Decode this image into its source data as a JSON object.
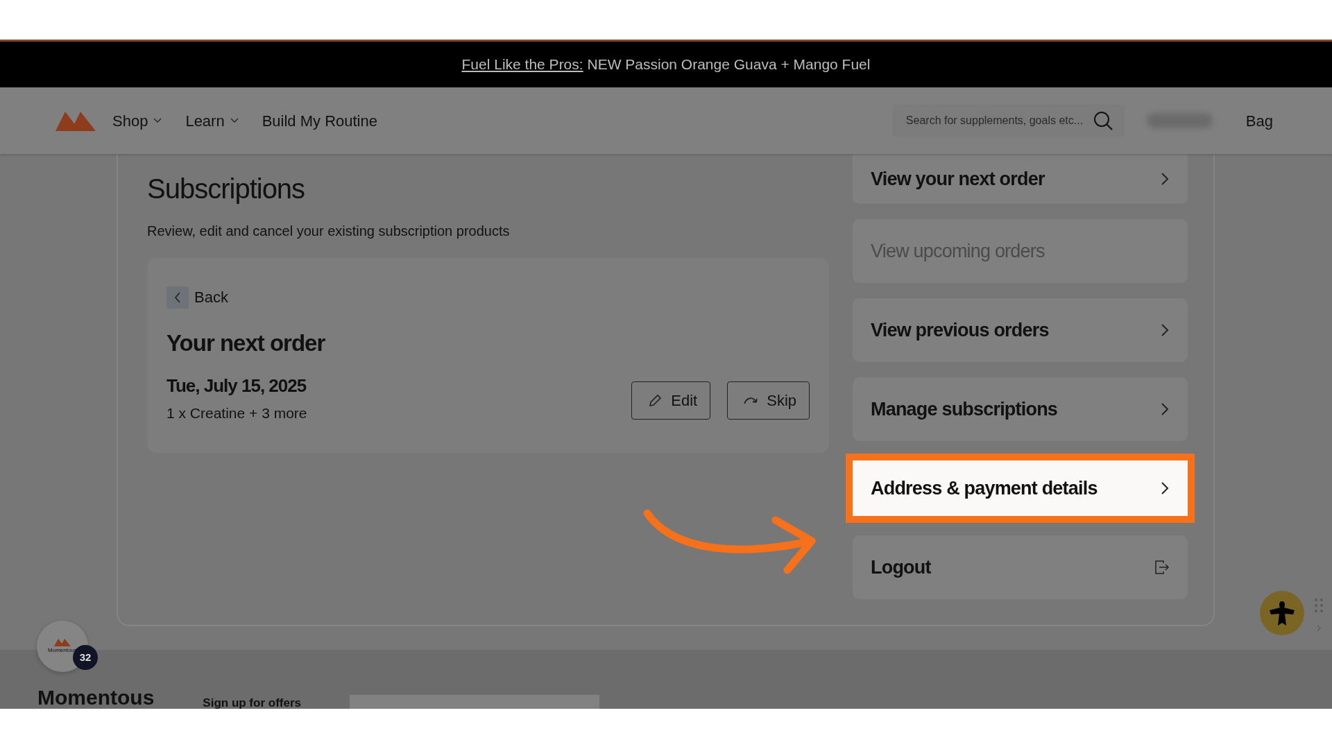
{
  "banner": {
    "link": "Fuel Like the Pros:",
    "text": "NEW Passion Orange Guava + Mango Fuel"
  },
  "nav": {
    "items": [
      {
        "label": "Shop",
        "kind": "dropdown"
      },
      {
        "label": "Learn",
        "kind": "dropdown"
      },
      {
        "label": "Build My Routine",
        "kind": "link"
      }
    ],
    "search": {
      "placeholder": "Search for supplements, goals etc..."
    },
    "bag": "Bag"
  },
  "page": {
    "title": "Subscriptions",
    "subtitle": "Review, edit and cancel your existing subscription products"
  },
  "order_card": {
    "back": "Back",
    "heading": "Your next order",
    "date": "Tue, July 15, 2025",
    "summary": "1 x Creatine + 3 more",
    "buttons": [
      {
        "label": "Edit",
        "kind": "edit"
      },
      {
        "label": "Skip",
        "kind": "skip"
      }
    ]
  },
  "menu": [
    {
      "label": "View your next order",
      "kind": "chevron",
      "disabled": false,
      "selected": false
    },
    {
      "label": "View upcoming orders",
      "kind": "none",
      "disabled": true,
      "selected": false
    },
    {
      "label": "View previous orders",
      "kind": "chevron",
      "disabled": false,
      "selected": false
    },
    {
      "label": "Manage subscriptions",
      "kind": "chevron",
      "disabled": false,
      "selected": false
    },
    {
      "label": "Address & payment details",
      "kind": "chevron",
      "disabled": false,
      "selected": true
    },
    {
      "label": "Logout",
      "kind": "logout",
      "disabled": false,
      "selected": false
    }
  ],
  "chat": {
    "logo_text": "Momentous",
    "badge": "32"
  },
  "footer": {
    "brand": "Momentous",
    "signup": "Sign up for offers"
  }
}
